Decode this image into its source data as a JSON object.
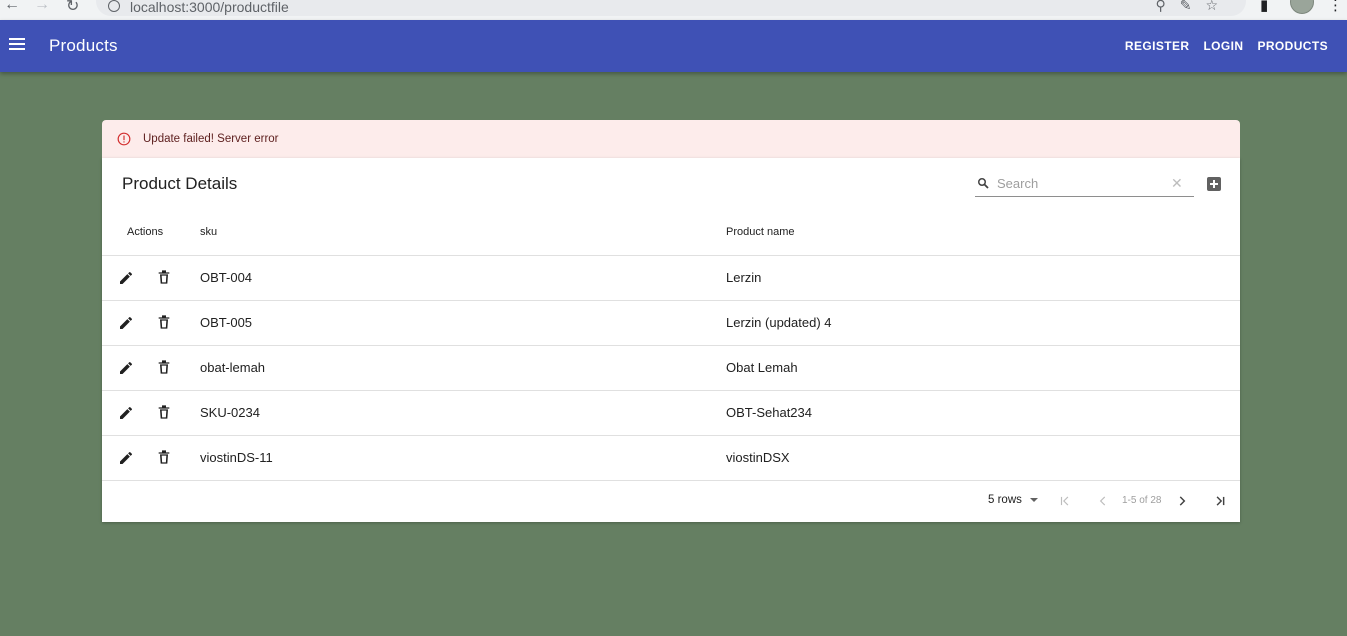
{
  "browser": {
    "url": "localhost:3000/productfile"
  },
  "appbar": {
    "title": "Products",
    "links": [
      "REGISTER",
      "LOGIN",
      "PRODUCTS"
    ],
    "color": "#3f51b5"
  },
  "alert": {
    "message": "Update failed! Server error",
    "severity": "error",
    "icon": "error-outline-icon"
  },
  "table": {
    "title": "Product Details",
    "search_placeholder": "Search",
    "columns": [
      "Actions",
      "sku",
      "Product name"
    ],
    "rows": [
      {
        "sku": "OBT-004",
        "name": "Lerzin"
      },
      {
        "sku": "OBT-005",
        "name": "Lerzin (updated) 4"
      },
      {
        "sku": "obat-lemah",
        "name": "Obat Lemah"
      },
      {
        "sku": "SKU-0234",
        "name": "OBT-Sehat234"
      },
      {
        "sku": "viostinDS-11",
        "name": "viostinDSX"
      }
    ],
    "pagination": {
      "rows_per_page": "5 rows",
      "range": "1-5 of 28"
    }
  }
}
